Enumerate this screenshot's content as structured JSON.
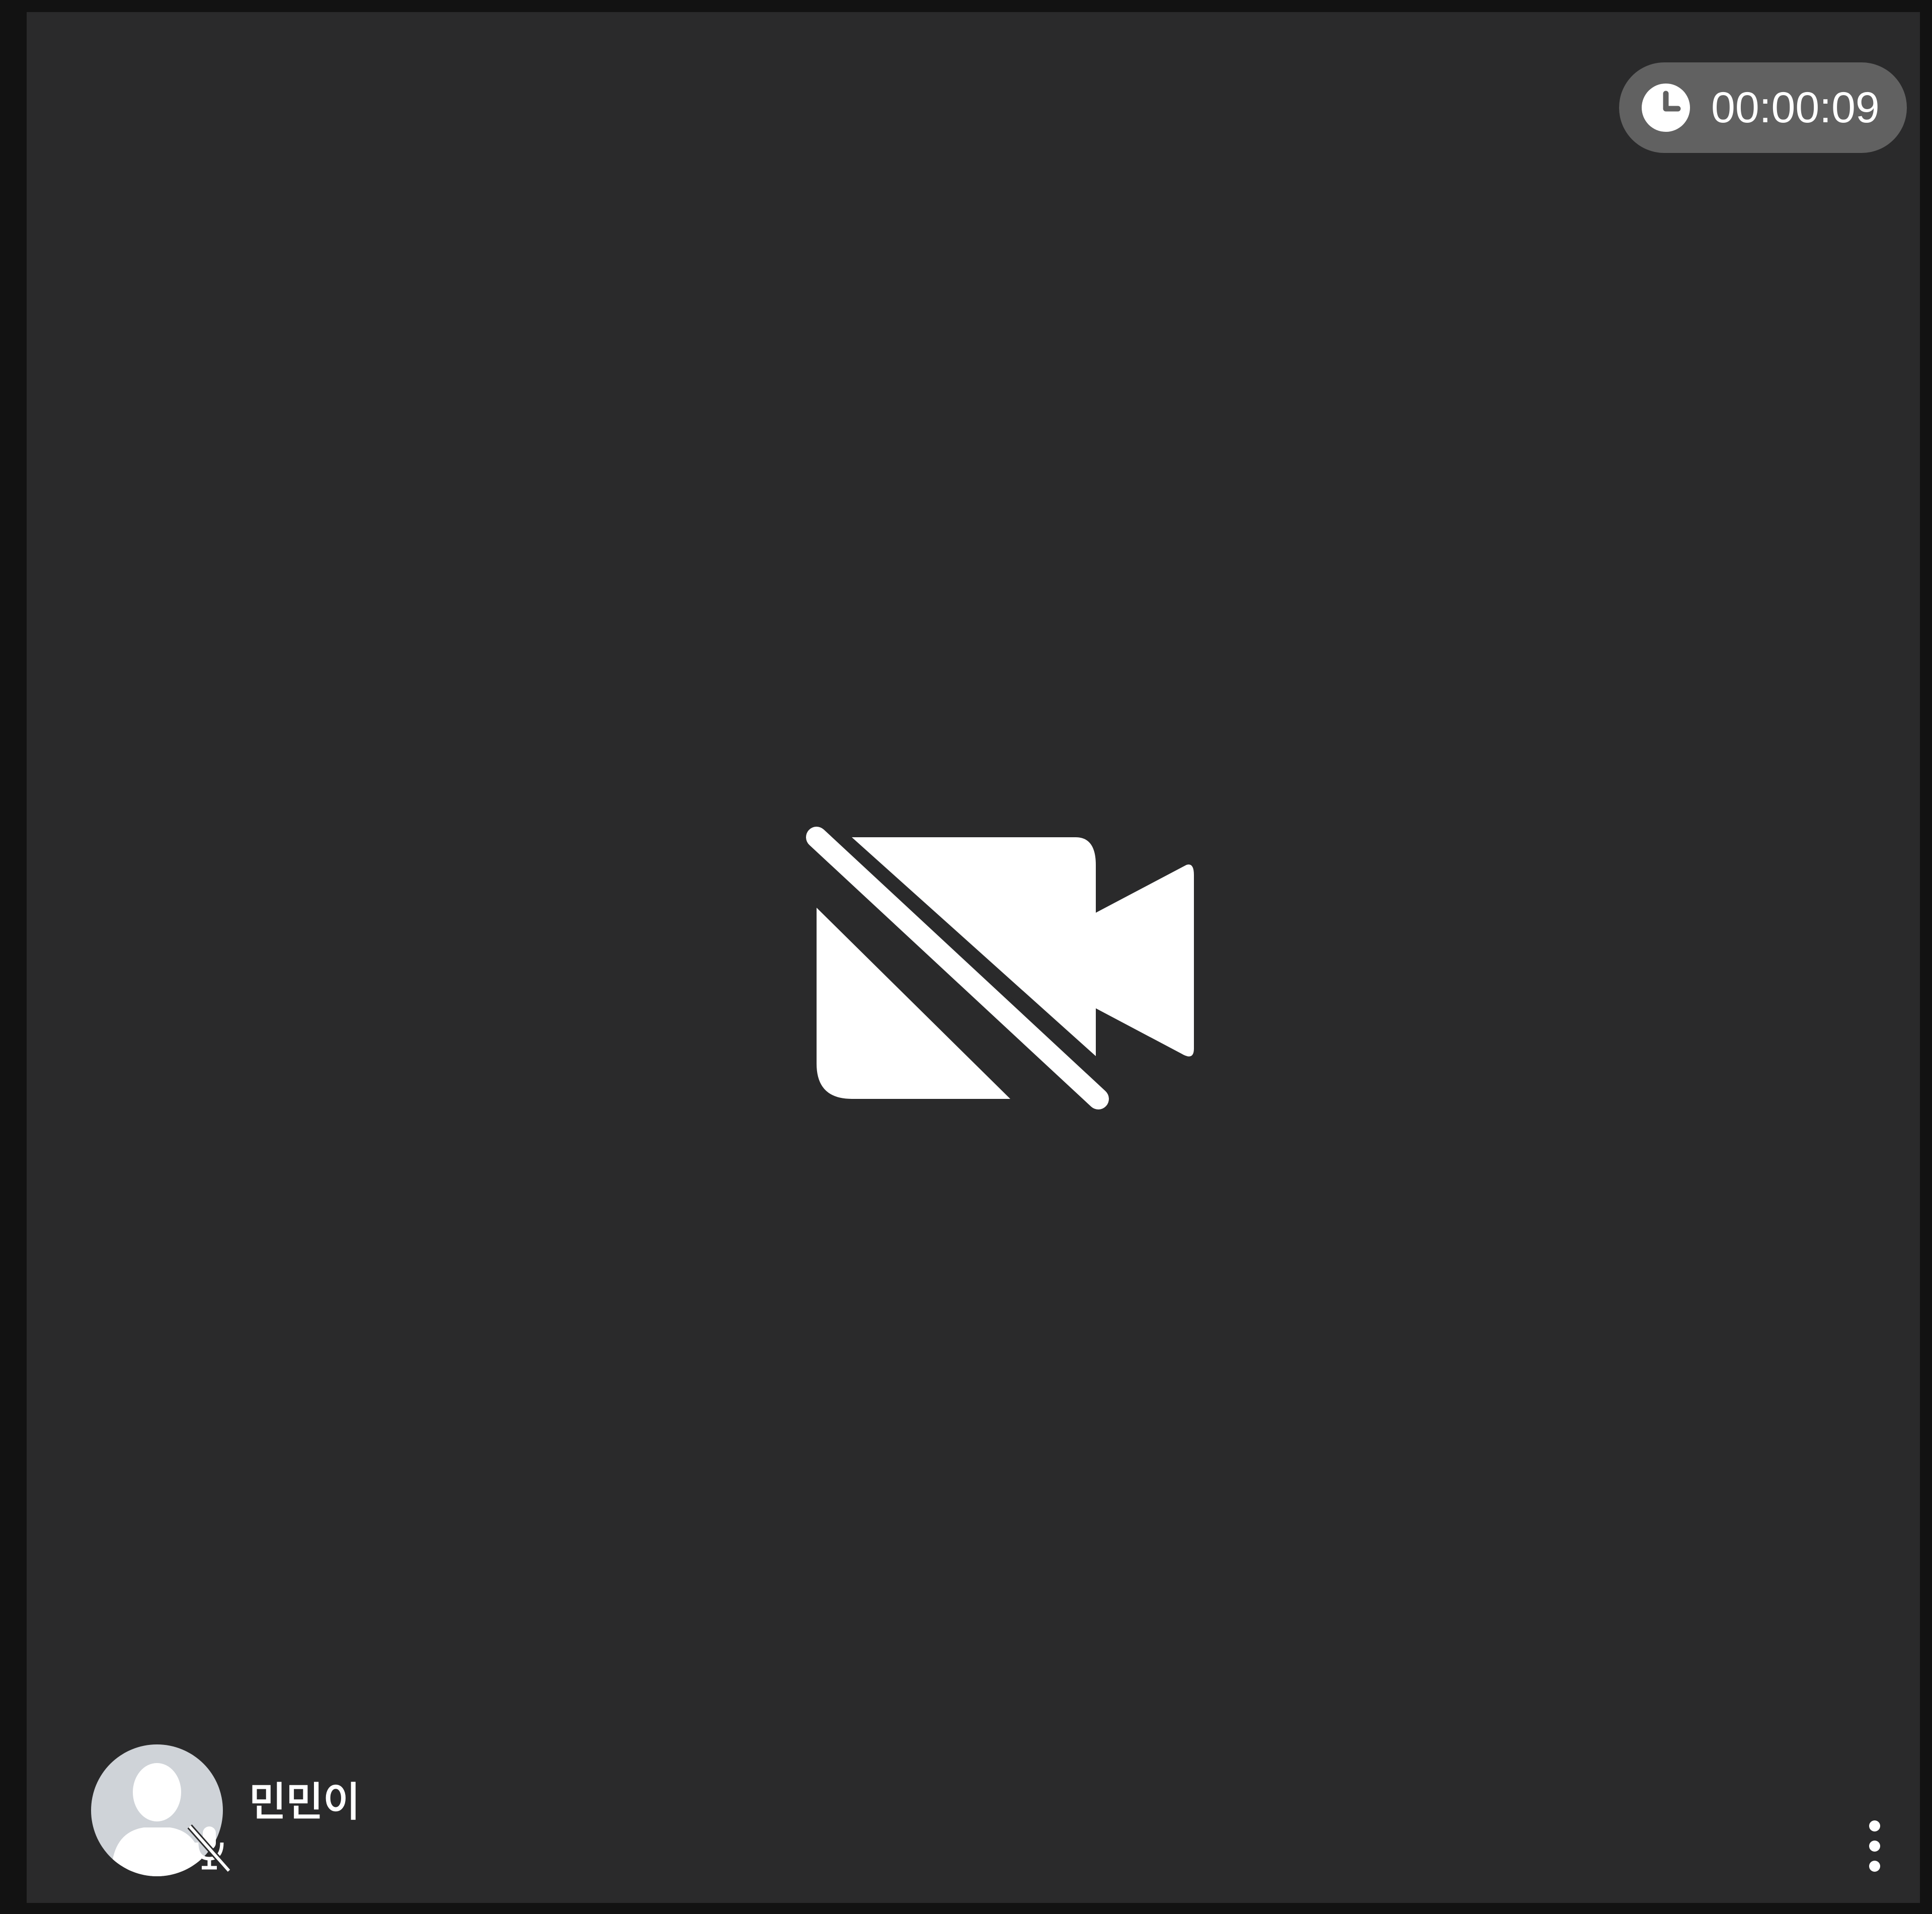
{
  "participant": {
    "name": "민민이",
    "camera": "off",
    "microphone": "muted",
    "avatar_icon": "default-user-silhouette"
  },
  "call_timer": {
    "elapsed": "00:00:09",
    "icon": "clock-icon"
  },
  "center_overlay": {
    "icon": "video-off-icon"
  },
  "tile_menu": {
    "icon": "more-vertical-icon"
  },
  "colors": {
    "page_background": "#121212",
    "tile_background": "#2a2a2b",
    "timer_pill": "#616161",
    "icon": "#ffffff",
    "avatar_background": "#cfd3d8"
  }
}
